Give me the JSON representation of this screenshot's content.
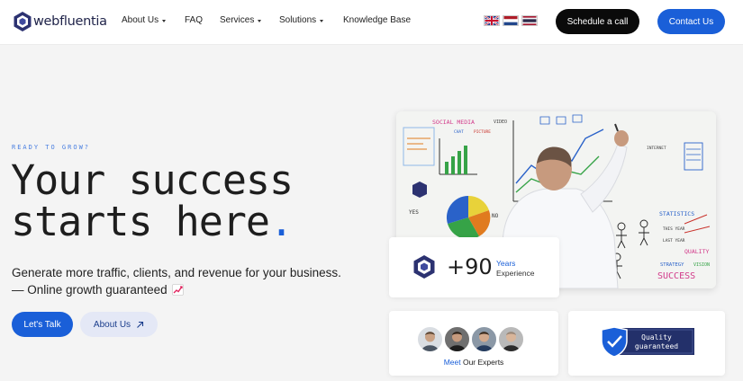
{
  "brand": {
    "name": "webfluentia",
    "logo_icon": "hexagon-logo-icon",
    "color_primary": "#1a5fd8",
    "color_dark": "#0a0a0a"
  },
  "nav": {
    "items": [
      {
        "label": "About Us",
        "has_dropdown": true
      },
      {
        "label": "FAQ",
        "has_dropdown": false
      },
      {
        "label": "Services",
        "has_dropdown": true
      },
      {
        "label": "Solutions",
        "has_dropdown": true
      },
      {
        "label": "Knowledge Base",
        "has_dropdown": false
      }
    ]
  },
  "languages": [
    {
      "icon": "flag-uk-icon"
    },
    {
      "icon": "flag-netherlands-icon"
    },
    {
      "icon": "flag-thailand-icon"
    }
  ],
  "header_buttons": {
    "schedule": "Schedule a call",
    "contact": "Contact Us"
  },
  "hero": {
    "eyebrow": "READY TO GROW?",
    "headline_line1": "Your success",
    "headline_line2": "starts here",
    "headline_dot": ".",
    "subtitle_line1": "Generate more traffic, clients, and revenue for your business.",
    "subtitle_line2": "— Online growth guaranteed",
    "cta_primary": "Let's Talk",
    "cta_secondary": "About Us"
  },
  "stats": {
    "years_value": "+90",
    "years_label": "Years",
    "years_sub": "Experience"
  },
  "experts": {
    "label_highlight": "Meet",
    "label_rest": " Our Experts"
  },
  "quality": {
    "line1": "Quality",
    "line2": "guaranteed"
  },
  "photo": {
    "board_words": [
      "SOCIAL MEDIA",
      "VIDEO",
      "CHAT",
      "PICTURE",
      "INTERNET",
      "STATISTICS",
      "QUALITY",
      "SUCCESS",
      "STRATEGY",
      "VISION",
      "LAST YEAR",
      "THIS YEAR",
      "YES",
      "NO"
    ]
  }
}
